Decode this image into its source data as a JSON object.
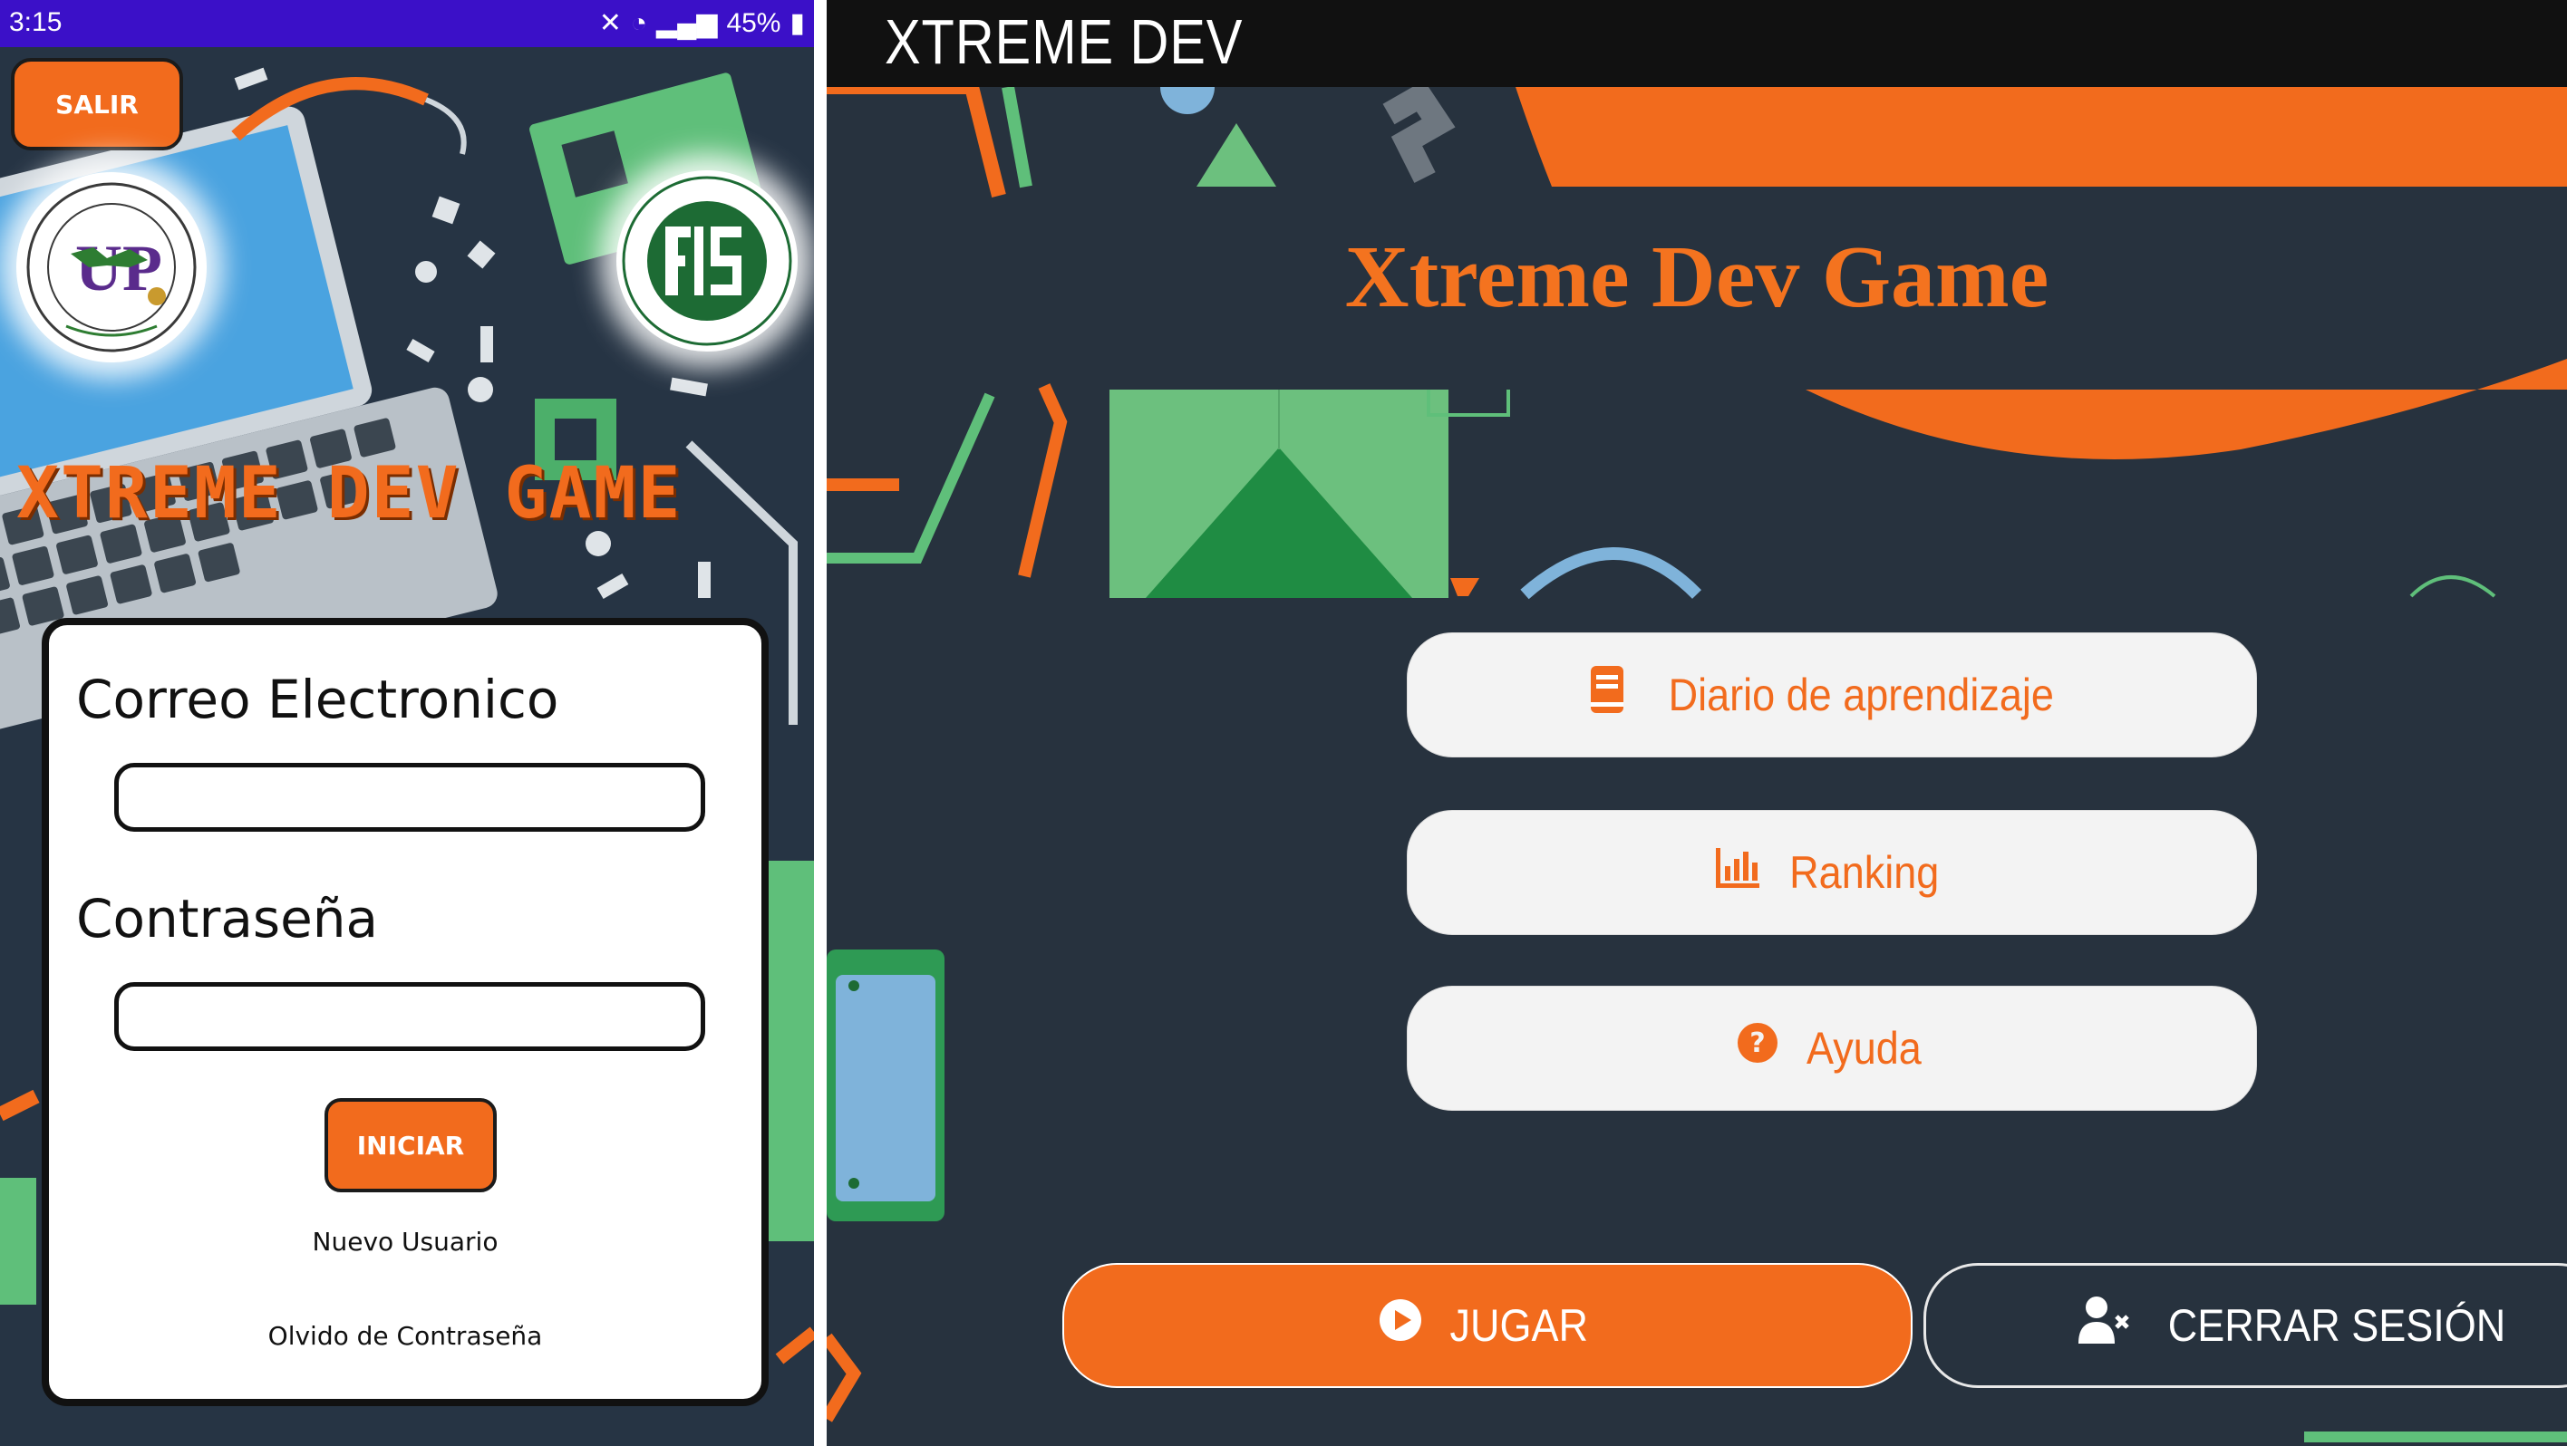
{
  "phone": {
    "status_bar": {
      "time": "3:15",
      "battery": "45%"
    },
    "exit_button_label": "SALIR",
    "game_title": "XTREME DEV GAME",
    "login": {
      "email_label": "Correo Electronico",
      "email_value": "",
      "password_label": "Contraseña",
      "password_value": "",
      "submit_label": "INICIAR",
      "new_user_link": "Nuevo Usuario",
      "forgot_password_link": "Olvido de Contraseña"
    },
    "colors": {
      "accent": "#f26b1d",
      "status_bar": "#3b10c8",
      "background": "#263444"
    }
  },
  "web": {
    "app_title": "XTREME DEV",
    "heading": "Xtreme Dev Game",
    "menu": [
      {
        "label": "Diario de aprendizaje",
        "icon": "book-icon"
      },
      {
        "label": "Ranking",
        "icon": "bar-chart-icon"
      },
      {
        "label": "Ayuda",
        "icon": "question-circle-icon"
      }
    ],
    "play_button_label": "JUGAR",
    "logout_button_label": "CERRAR SESIÓN",
    "colors": {
      "accent": "#f26b1d",
      "background": "#27323e",
      "topbar": "#111111"
    }
  }
}
